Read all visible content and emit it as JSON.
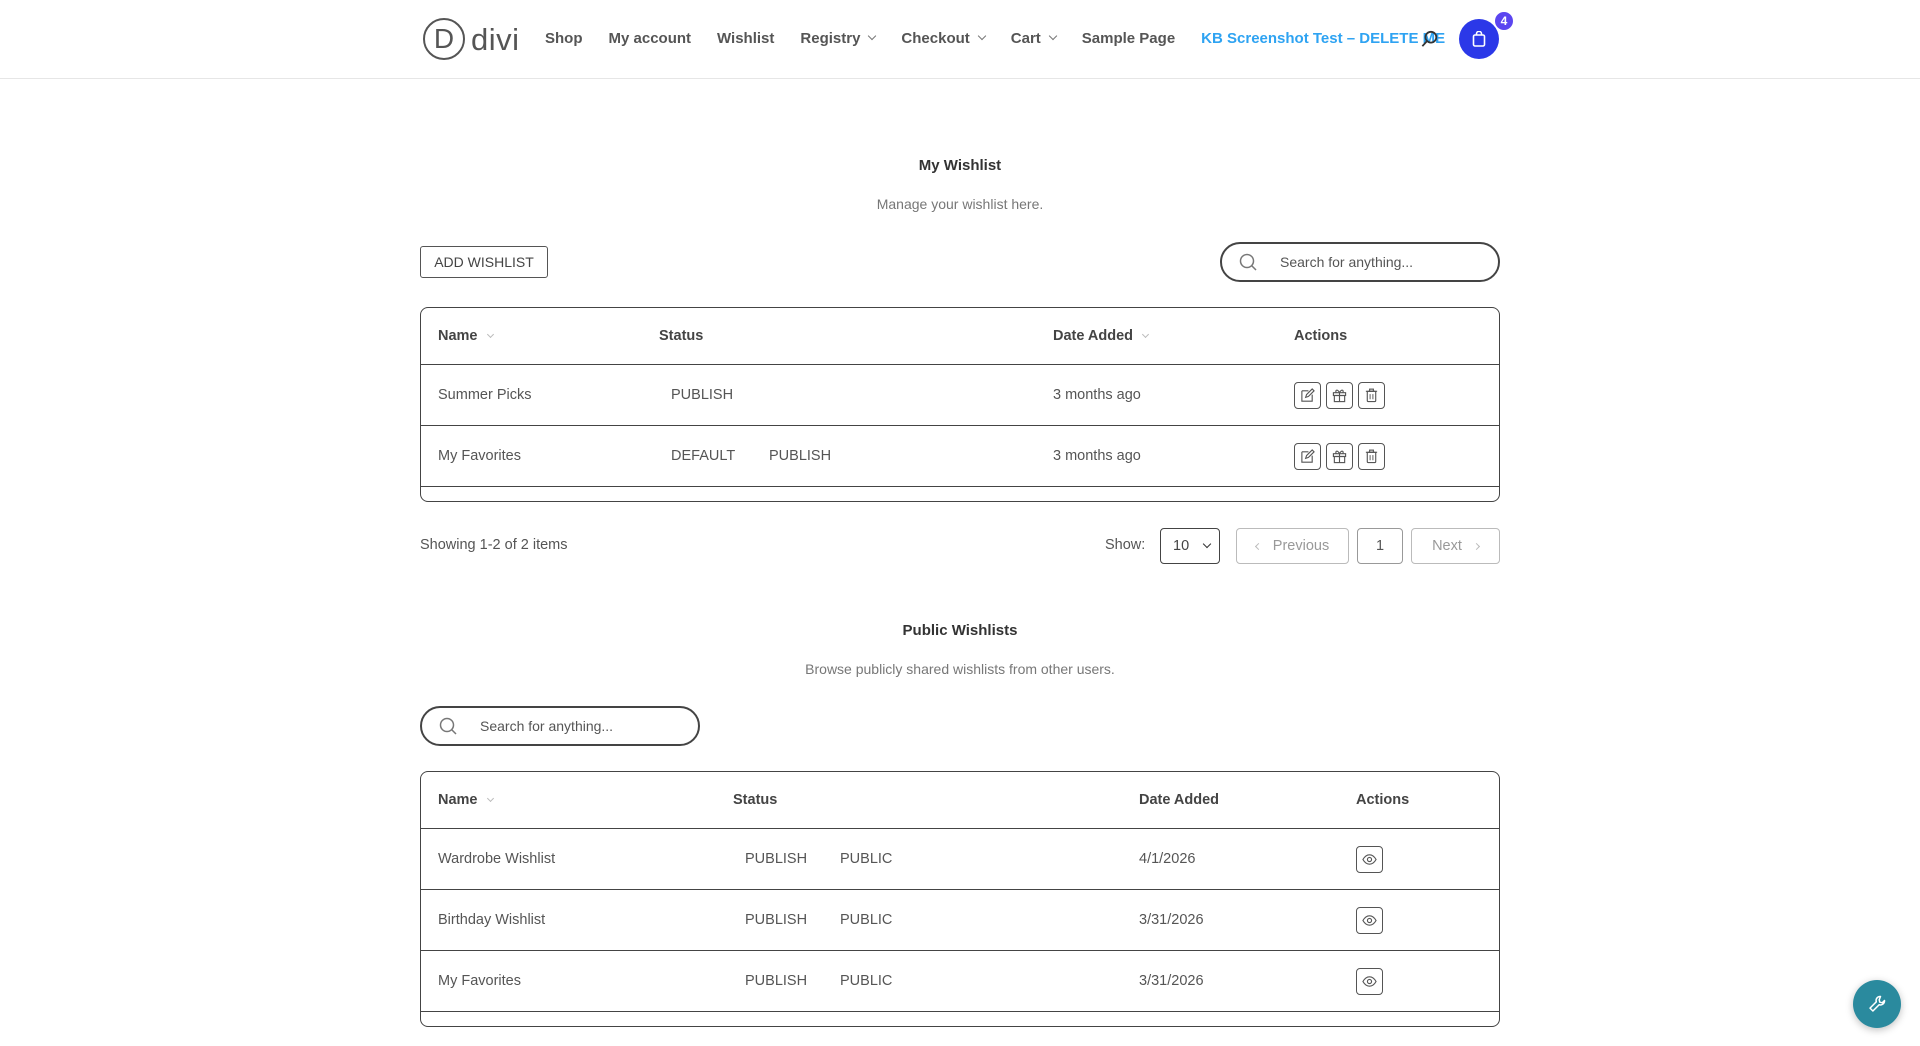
{
  "header": {
    "logo_letter": "D",
    "logo_text": "divi",
    "nav": [
      {
        "label": "Shop",
        "dropdown": false
      },
      {
        "label": "My account",
        "dropdown": false
      },
      {
        "label": "Wishlist",
        "dropdown": false
      },
      {
        "label": "Registry",
        "dropdown": true
      },
      {
        "label": "Checkout",
        "dropdown": true
      },
      {
        "label": "Cart",
        "dropdown": true
      },
      {
        "label": "Sample Page",
        "dropdown": false
      },
      {
        "label": "KB Screenshot Test – DELETE ME",
        "dropdown": false,
        "active": true
      }
    ],
    "cart_count": "4",
    "accent_color": "#2ea3f2",
    "cart_color": "#2b38e8"
  },
  "my_wishlist": {
    "title": "My Wishlist",
    "subtitle": "Manage your wishlist here.",
    "add_button": "ADD WISHLIST",
    "search_placeholder": "Search for anything...",
    "columns": [
      "Name",
      "Status",
      "Date Added",
      "Actions"
    ],
    "rows": [
      {
        "name": "Summer Picks",
        "tags": [
          "PUBLISH"
        ],
        "date": "3 months ago"
      },
      {
        "name": "My Favorites",
        "tags": [
          "DEFAULT",
          "PUBLISH"
        ],
        "date": "3 months ago"
      }
    ],
    "showing": "Showing 1-2 of 2 items",
    "show_label": "Show:",
    "per_page": "10",
    "prev_label": "Previous",
    "page": "1",
    "next_label": "Next"
  },
  "public_wishlists": {
    "title": "Public Wishlists",
    "subtitle": "Browse publicly shared wishlists from other users.",
    "search_placeholder": "Search for anything...",
    "columns": [
      "Name",
      "Status",
      "Date Added",
      "Actions"
    ],
    "rows": [
      {
        "name": "Wardrobe Wishlist",
        "tags": [
          "PUBLISH",
          "PUBLIC"
        ],
        "date": "4/1/2026"
      },
      {
        "name": "Birthday Wishlist",
        "tags": [
          "PUBLISH",
          "PUBLIC"
        ],
        "date": "3/31/2026"
      },
      {
        "name": "My Favorites",
        "tags": [
          "PUBLISH",
          "PUBLIC"
        ],
        "date": "3/31/2026"
      }
    ]
  },
  "icons": {
    "edit": "edit-icon",
    "gift": "gift-icon",
    "delete": "trash-icon",
    "view": "eye-icon",
    "search": "search-icon",
    "cart": "shopping-bag-icon",
    "fab": "wrench-icon"
  }
}
